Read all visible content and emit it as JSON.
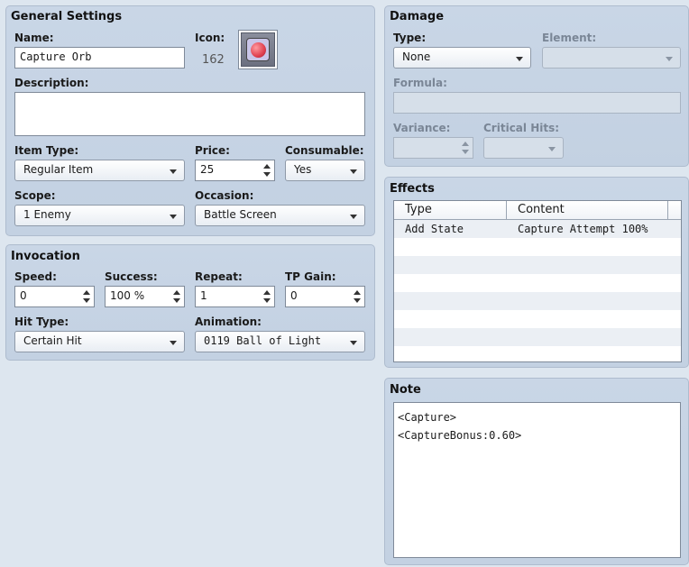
{
  "general": {
    "title": "General Settings",
    "name_label": "Name:",
    "name_value": "Capture Orb",
    "icon_label": "Icon:",
    "icon_index": "162",
    "description_label": "Description:",
    "description_value": "",
    "item_type_label": "Item Type:",
    "item_type_value": "Regular Item",
    "price_label": "Price:",
    "price_value": "25",
    "consumable_label": "Consumable:",
    "consumable_value": "Yes",
    "scope_label": "Scope:",
    "scope_value": "1 Enemy",
    "occasion_label": "Occasion:",
    "occasion_value": "Battle Screen"
  },
  "invocation": {
    "title": "Invocation",
    "speed_label": "Speed:",
    "speed_value": "0",
    "success_label": "Success:",
    "success_value": "100 %",
    "repeat_label": "Repeat:",
    "repeat_value": "1",
    "tp_gain_label": "TP Gain:",
    "tp_gain_value": "0",
    "hit_type_label": "Hit Type:",
    "hit_type_value": "Certain Hit",
    "animation_label": "Animation:",
    "animation_value": "0119 Ball of Light"
  },
  "damage": {
    "title": "Damage",
    "type_label": "Type:",
    "type_value": "None",
    "element_label": "Element:",
    "element_value": "",
    "formula_label": "Formula:",
    "formula_value": "",
    "variance_label": "Variance:",
    "variance_value": "",
    "critical_label": "Critical Hits:",
    "critical_value": ""
  },
  "effects": {
    "title": "Effects",
    "columns": [
      "Type",
      "Content"
    ],
    "rows": [
      [
        "Add State",
        "Capture Attempt 100%"
      ],
      [
        "",
        ""
      ],
      [
        "",
        ""
      ],
      [
        "",
        ""
      ],
      [
        "",
        ""
      ],
      [
        "",
        ""
      ],
      [
        "",
        ""
      ],
      [
        "",
        ""
      ]
    ]
  },
  "note": {
    "title": "Note",
    "lines": [
      "<Capture>",
      "<CaptureBonus:0.60>"
    ]
  },
  "icons": {
    "icon_preview": "red-orb-icon",
    "dropdown_arrow": "chevron-down-icon",
    "spinner": "spinner-arrows-icon"
  },
  "colors": {
    "background": "#dde6ef",
    "panel": "#c6d3e4",
    "field": "#ffffff",
    "disabled_field": "#d6dfe9"
  }
}
